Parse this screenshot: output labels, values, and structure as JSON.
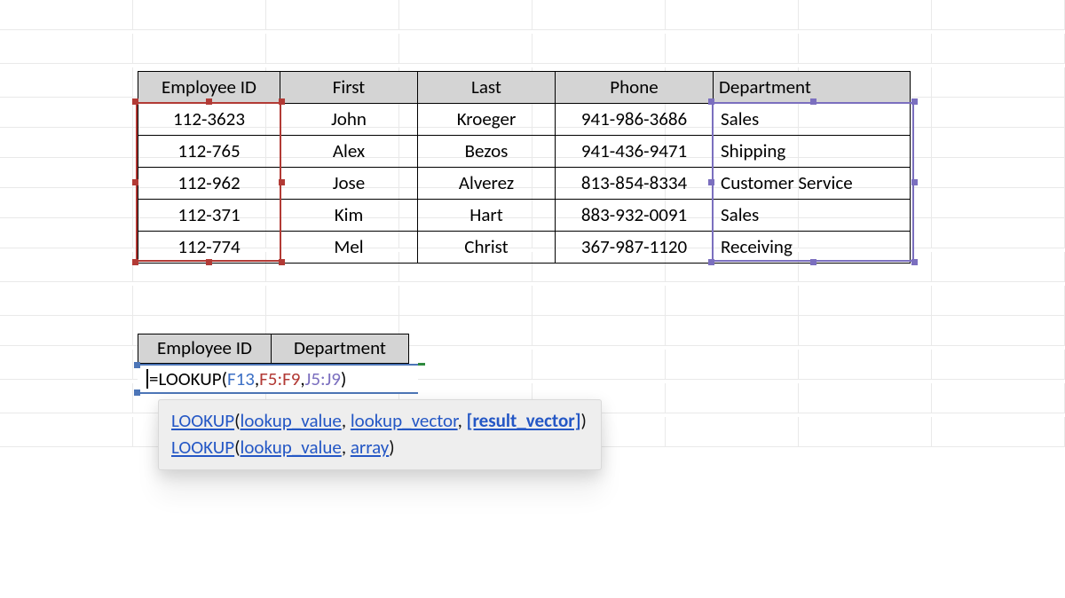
{
  "table": {
    "headers": [
      "Employee ID",
      "First",
      "Last",
      "Phone",
      "Department"
    ],
    "rows": [
      {
        "id": "112-3623",
        "first": "John",
        "last": "Kroeger",
        "phone": "941-986-3686",
        "dept": "Sales"
      },
      {
        "id": "112-765",
        "first": "Alex",
        "last": "Bezos",
        "phone": "941-436-9471",
        "dept": "Shipping"
      },
      {
        "id": "112-962",
        "first": "Jose",
        "last": "Alverez",
        "phone": "813-854-8334",
        "dept": "Customer Service"
      },
      {
        "id": "112-371",
        "first": "Kim",
        "last": "Hart",
        "phone": "883-932-0091",
        "dept": "Sales"
      },
      {
        "id": "112-774",
        "first": "Mel",
        "last": "Christ",
        "phone": "367-987-1120",
        "dept": "Receiving"
      }
    ]
  },
  "lookup": {
    "headers": [
      "Employee ID",
      "Department"
    ],
    "formula": {
      "prefix": "=",
      "fn": "LOOKUP",
      "open": "(",
      "arg1": "F13",
      "sep1": ",",
      "arg2": "F5:F9",
      "sep2": ",",
      "arg3": "J5:J9",
      "close": ")"
    }
  },
  "tooltip": {
    "sig1": {
      "fn": "LOOKUP",
      "a1": "lookup_value",
      "a2": "lookup_vector",
      "a3": "[result_vector]"
    },
    "sig2": {
      "fn": "LOOKUP",
      "a1": "lookup_value",
      "a2": "array"
    }
  },
  "colors": {
    "headerFill": "#d4d4d4",
    "selectionRed": "#b23a35",
    "selectionPurple": "#7b6fbf",
    "selectionBlue": "#4c75b7",
    "selectionGreen": "#2f8a3e",
    "link": "#2457c5"
  }
}
